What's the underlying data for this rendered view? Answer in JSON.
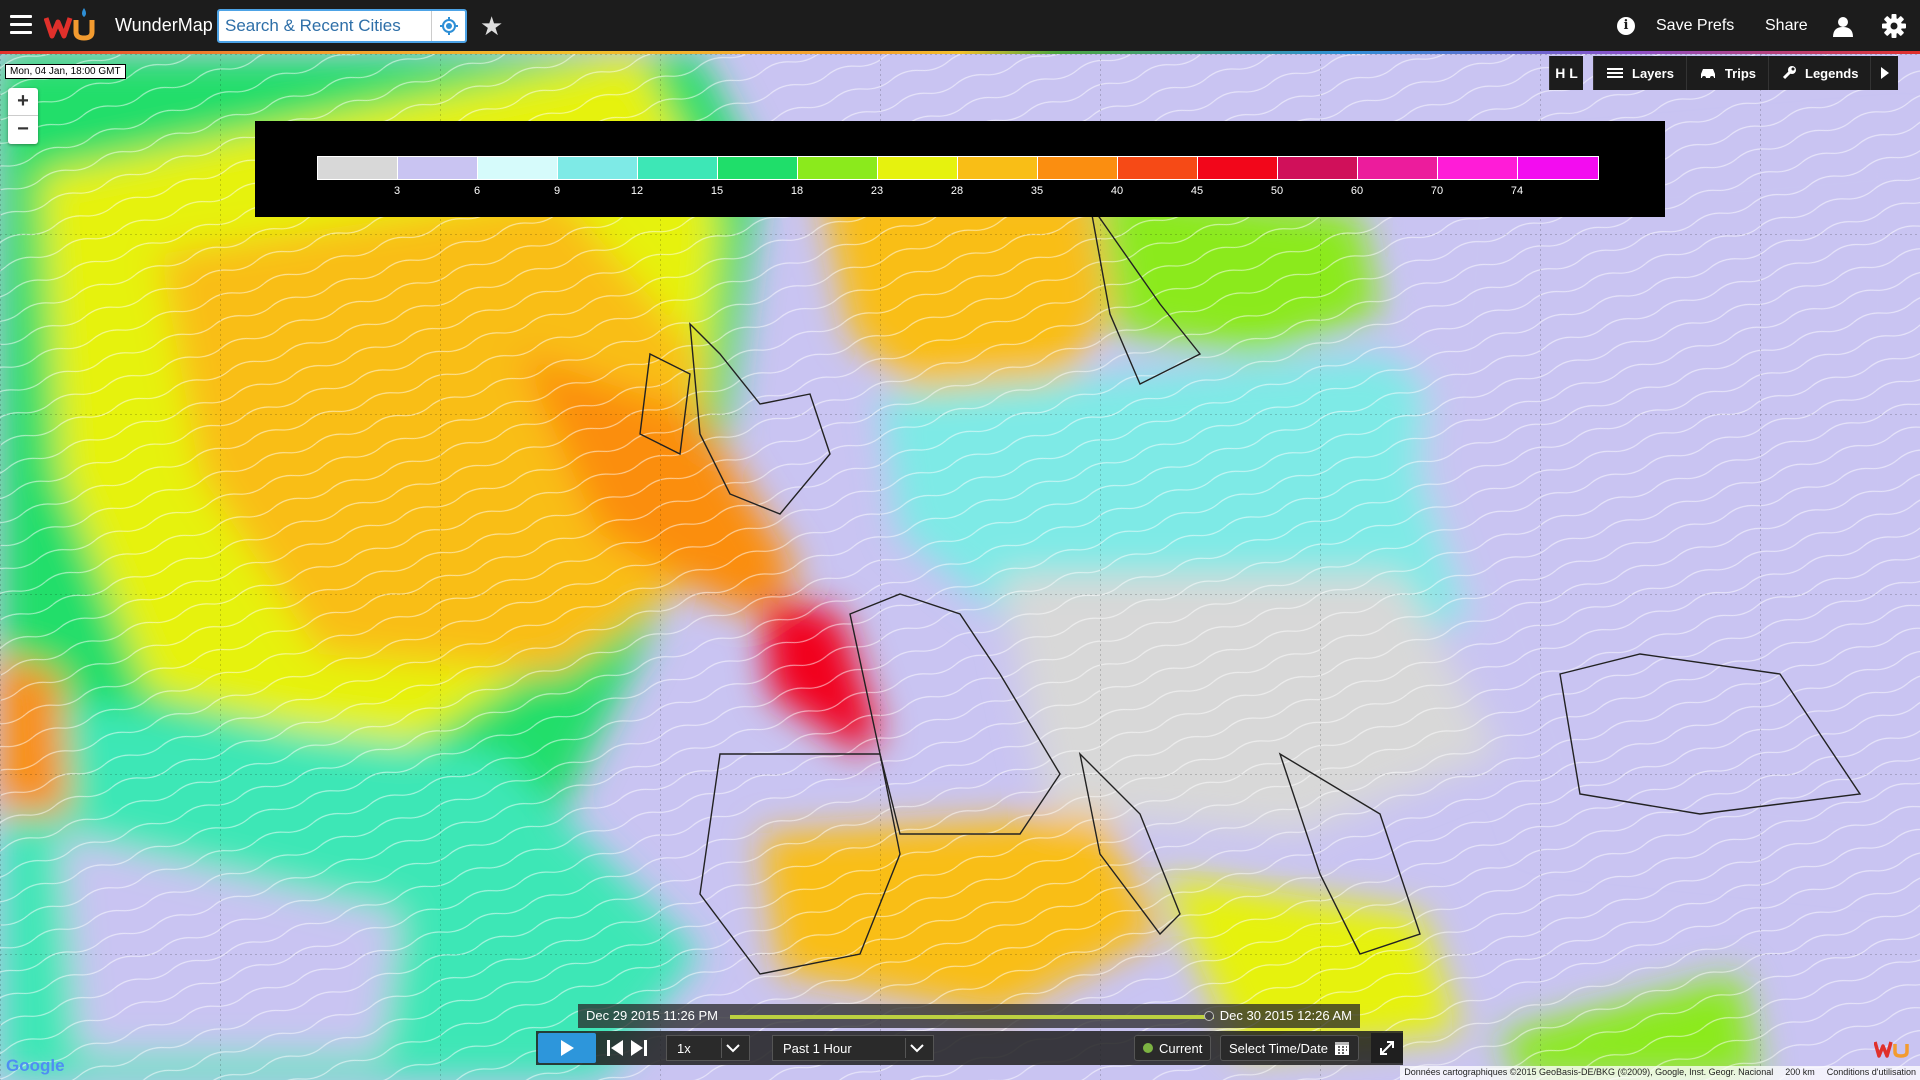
{
  "app": {
    "title": "WunderMap"
  },
  "search": {
    "placeholder": "Search & Recent Cities"
  },
  "header": {
    "save_prefs": "Save Prefs",
    "share": "Share"
  },
  "map": {
    "timestamp": "Mon, 04 Jan, 18:00 GMT",
    "zoom_in": "+",
    "zoom_out": "−"
  },
  "legend": {
    "labels": [
      "3",
      "6",
      "9",
      "12",
      "15",
      "18",
      "23",
      "28",
      "35",
      "40",
      "45",
      "50",
      "60",
      "70",
      "74"
    ],
    "colors": [
      "#d8d8d8",
      "#c9c4f2",
      "#d6fbfb",
      "#7eeae6",
      "#3de7b6",
      "#1fde6a",
      "#8bea1c",
      "#e6f20e",
      "#f9be16",
      "#fb8e10",
      "#f64a16",
      "#f2061a",
      "#d0105a",
      "#ec1c9c",
      "#ff1cd7",
      "#f30cf0"
    ]
  },
  "map_tools": {
    "hl_label": "H L",
    "layers": "Layers",
    "trips": "Trips",
    "legends": "Legends"
  },
  "animation": {
    "start_time": "Dec 29 2015 11:26 PM",
    "end_time": "Dec 30 2015 12:26 AM",
    "speed": "1x",
    "range": "Past 1 Hour",
    "current": "Current",
    "select_time": "Select Time/Date",
    "progress": 0.99
  },
  "footer": {
    "google": "Google",
    "attribution": "Données cartographiques ©2015 GeoBasis-DE/BKG (©2009), Google, Inst. Geogr. Nacional",
    "scale": "200 km",
    "terms": "Conditions d'utilisation"
  },
  "colors": {
    "accent": "#2d96db",
    "topbar": "#1c1c1c"
  }
}
